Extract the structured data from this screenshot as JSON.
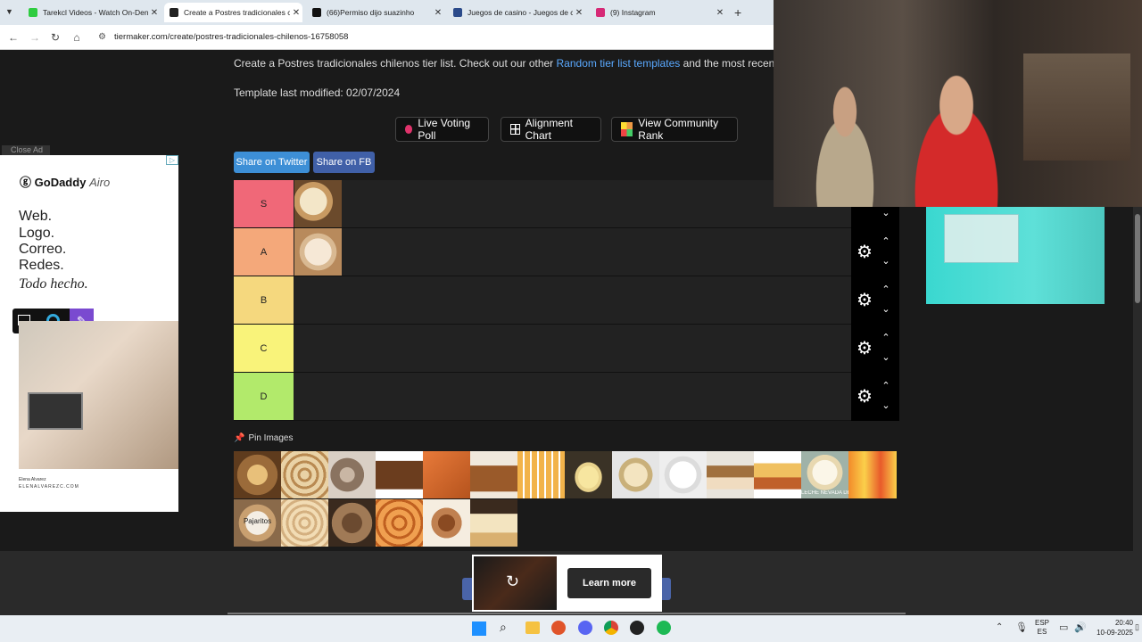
{
  "tabs": [
    {
      "label": "Tarekcl Videos - Watch On-Den",
      "color": "#2ecc40"
    },
    {
      "label": "Create a Postres tradicionales c",
      "color": "#222222"
    },
    {
      "label": "(66)Permiso dijo suazinho",
      "color": "#111111"
    },
    {
      "label": "Juegos de casino - Juegos de c",
      "color": "#2b4a8a"
    },
    {
      "label": "(9) Instagram",
      "color": "#d62976"
    }
  ],
  "url": "tiermaker.com/create/postres-tradicionales-chilenos-16758058",
  "intro": {
    "prefix": "Create a Postres tradicionales chilenos tier list. Check out our other ",
    "link": "Random tier list templates",
    "suffix": " and the most recent user s"
  },
  "modified": "Template last modified: 02/07/2024",
  "buttons": {
    "live": "Live Voting Poll",
    "alignment": "Alignment Chart",
    "community": "View Community Rank",
    "twitter": "Share on Twitter",
    "fb": "Share on FB"
  },
  "tiers": [
    {
      "label": "S",
      "color": "#f06878"
    },
    {
      "label": "A",
      "color": "#f4a87a"
    },
    {
      "label": "B",
      "color": "#f5d87e"
    },
    {
      "label": "C",
      "color": "#f9f37a"
    },
    {
      "label": "D",
      "color": "#b2ea6b"
    }
  ],
  "pin_images": "Pin Images",
  "pin_label": "Pajaritos",
  "pool_caption": "LECHE NEVADA DE CORSETO",
  "ad": {
    "close": "Close Ad",
    "brand": "GoDaddy",
    "brand2": "Airo",
    "lines": [
      "Web.",
      "Logo.",
      "Correo.",
      "Redes."
    ],
    "tagline": "Todo hecho.",
    "credit1": "Elena Alvarez",
    "credit2": "ELENALVAREZC.COM"
  },
  "learn_more": "Learn more",
  "tray": {
    "lang1": "ESP",
    "lang2": "ES",
    "time": "20:40",
    "date": "10-09-2025"
  }
}
